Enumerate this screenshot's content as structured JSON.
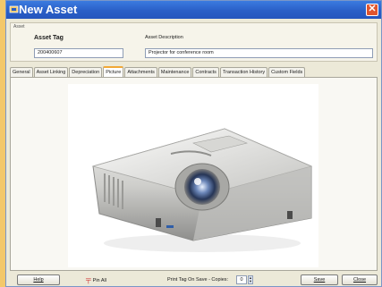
{
  "window": {
    "title": "New Asset"
  },
  "asset_group": {
    "caption": "Asset",
    "tag_label": "Asset Tag",
    "tag_value": "200400607",
    "description_label": "Asset Description",
    "description_value": "Projector for conference room"
  },
  "tabs": [
    {
      "label": "General",
      "active": false
    },
    {
      "label": "Asset Linking",
      "active": false
    },
    {
      "label": "Depreciation",
      "active": false
    },
    {
      "label": "Picture",
      "active": true
    },
    {
      "label": "Attachments",
      "active": false
    },
    {
      "label": "Maintenance",
      "active": false
    },
    {
      "label": "Contracts",
      "active": false
    },
    {
      "label": "Transaction History",
      "active": false
    },
    {
      "label": "Custom Fields",
      "active": false
    }
  ],
  "footer": {
    "help_label": "Help",
    "pin_label": "Pin All",
    "print_label": "Print Tag On Save - Copies:",
    "copies_value": "0",
    "save_label": "Save",
    "close_label": "Close"
  },
  "icons": {
    "title": "asset-window-icon",
    "close": "close-icon",
    "pin": "pin-icon",
    "spinner": "spinner-arrows-icon"
  },
  "colors": {
    "titlebar": "#2a5fc7",
    "close": "#e0552e",
    "active_tab_accent": "#f1a836",
    "projector_body": "#c9c9c7"
  }
}
